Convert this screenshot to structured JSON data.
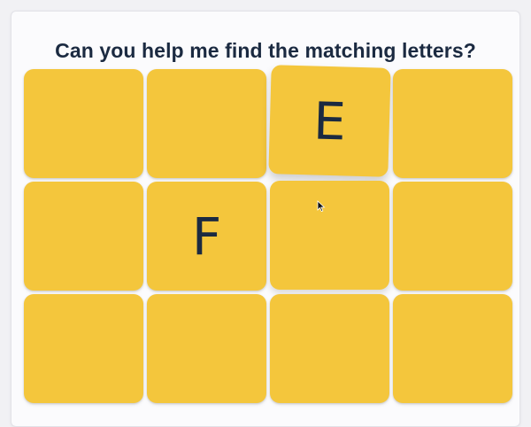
{
  "header": {
    "title": "Can you help me find the matching letters?"
  },
  "cards": [
    {
      "letter": ""
    },
    {
      "letter": ""
    },
    {
      "letter": "E"
    },
    {
      "letter": ""
    },
    {
      "letter": ""
    },
    {
      "letter": "F"
    },
    {
      "letter": ""
    },
    {
      "letter": ""
    },
    {
      "letter": ""
    },
    {
      "letter": ""
    },
    {
      "letter": ""
    },
    {
      "letter": ""
    }
  ],
  "colors": {
    "card": "#f4c63c",
    "text": "#1b2a41",
    "panel": "#fbfbfd"
  }
}
